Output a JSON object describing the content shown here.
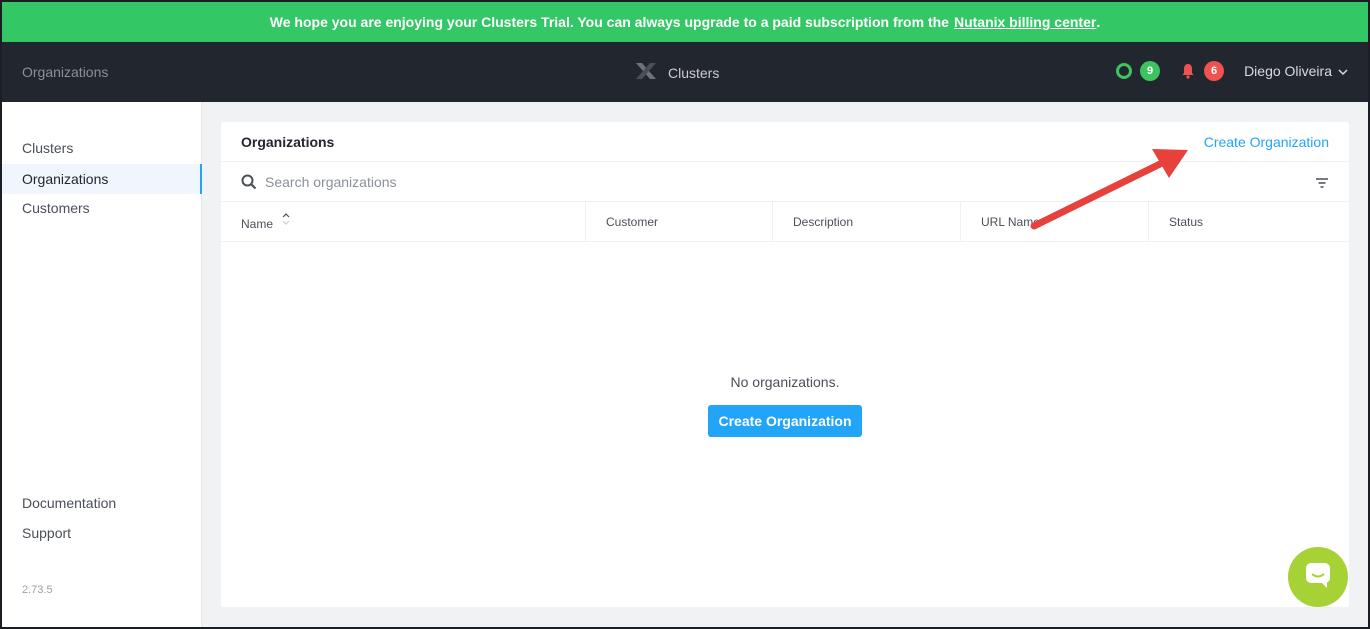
{
  "banner": {
    "text": "We hope you are enjoying your Clusters Trial. You can always upgrade to a paid subscription from the",
    "link": "Nutanix billing center",
    "suffix": ".",
    "color": "#34c766"
  },
  "topbar": {
    "breadcrumb": "Organizations",
    "app_name": "Clusters",
    "app_icon": "nutanix-x-icon",
    "status_count": "9",
    "alert_count": "6",
    "user_name": "Diego Oliveira"
  },
  "sidebar": {
    "items": [
      {
        "label": "Clusters",
        "active": false
      },
      {
        "label": "Organizations",
        "active": true
      },
      {
        "label": "Customers",
        "active": false
      }
    ],
    "footer": [
      {
        "label": "Documentation"
      },
      {
        "label": "Support"
      }
    ],
    "version": "2.73.5"
  },
  "main": {
    "title": "Organizations",
    "create_link": "Create Organization",
    "search_placeholder": "Search organizations",
    "columns": [
      "Name",
      "Customer",
      "Description",
      "URL Name",
      "Status"
    ],
    "empty_text": "No organizations.",
    "empty_button": "Create Organization"
  },
  "colors": {
    "accent": "#22a5f7",
    "annotation_arrow": "#e8403a",
    "chat": "#a6d235"
  }
}
